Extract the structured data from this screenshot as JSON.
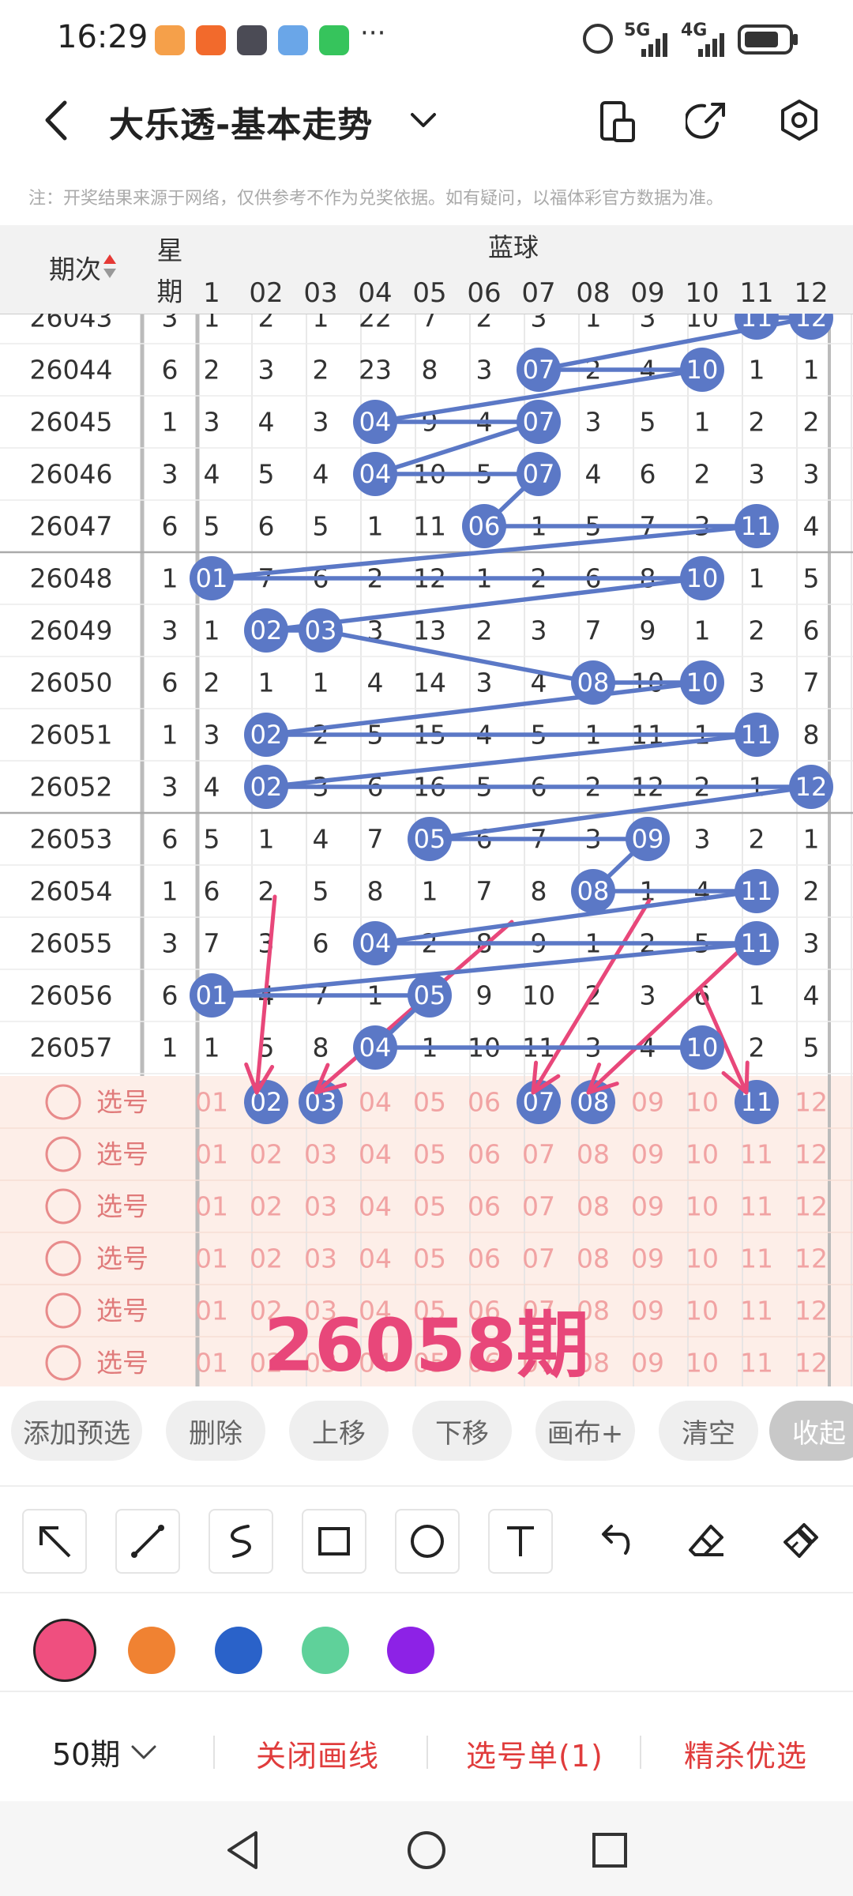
{
  "status": {
    "time": "16:29",
    "network_5g": "5G",
    "network_4g": "4G"
  },
  "header": {
    "title": "大乐透-基本走势"
  },
  "notice": "注：开奖结果来源于网络，仅供参考不作为兑奖依据。如有疑问，以福体彩官方数据为准。",
  "table": {
    "col_issue": "期次",
    "col_week": [
      "星",
      "期"
    ],
    "blue_header": "蓝球",
    "numbers": [
      "1",
      "02",
      "03",
      "04",
      "05",
      "06",
      "07",
      "08",
      "09",
      "10",
      "11",
      "12"
    ],
    "partial_row": {
      "issue": "26043",
      "week": "3",
      "values": [
        "1",
        "2",
        "1",
        "22",
        "7",
        "2",
        "3",
        "1",
        "3",
        "10",
        "11",
        "12"
      ]
    },
    "rows": [
      {
        "issue": "26044",
        "week": "6",
        "values": [
          "2",
          "3",
          "2",
          "23",
          "8",
          "3",
          "07",
          "2",
          "4",
          "10",
          "1",
          "1"
        ]
      },
      {
        "issue": "26045",
        "week": "1",
        "values": [
          "3",
          "4",
          "3",
          "04",
          "9",
          "4",
          "07",
          "3",
          "5",
          "1",
          "2",
          "2"
        ]
      },
      {
        "issue": "26046",
        "week": "3",
        "values": [
          "4",
          "5",
          "4",
          "04",
          "10",
          "5",
          "07",
          "4",
          "6",
          "2",
          "3",
          "3"
        ]
      },
      {
        "issue": "26047",
        "week": "6",
        "values": [
          "5",
          "6",
          "5",
          "1",
          "11",
          "06",
          "1",
          "5",
          "7",
          "3",
          "11",
          "4"
        ]
      },
      {
        "issue": "26048",
        "week": "1",
        "values": [
          "01",
          "7",
          "6",
          "2",
          "12",
          "1",
          "2",
          "6",
          "8",
          "10",
          "1",
          "5"
        ]
      },
      {
        "issue": "26049",
        "week": "3",
        "values": [
          "1",
          "02",
          "03",
          "3",
          "13",
          "2",
          "3",
          "7",
          "9",
          "1",
          "2",
          "6"
        ]
      },
      {
        "issue": "26050",
        "week": "6",
        "values": [
          "2",
          "1",
          "1",
          "4",
          "14",
          "3",
          "4",
          "08",
          "10",
          "10",
          "3",
          "7"
        ]
      },
      {
        "issue": "26051",
        "week": "1",
        "values": [
          "3",
          "02",
          "2",
          "5",
          "15",
          "4",
          "5",
          "1",
          "11",
          "1",
          "11",
          "8"
        ]
      },
      {
        "issue": "26052",
        "week": "3",
        "values": [
          "4",
          "02",
          "3",
          "6",
          "16",
          "5",
          "6",
          "2",
          "12",
          "2",
          "1",
          "12"
        ]
      },
      {
        "issue": "26053",
        "week": "6",
        "values": [
          "5",
          "1",
          "4",
          "7",
          "05",
          "6",
          "7",
          "3",
          "09",
          "3",
          "2",
          "1"
        ]
      },
      {
        "issue": "26054",
        "week": "1",
        "values": [
          "6",
          "2",
          "5",
          "8",
          "1",
          "7",
          "8",
          "08",
          "1",
          "4",
          "11",
          "2"
        ]
      },
      {
        "issue": "26055",
        "week": "3",
        "values": [
          "7",
          "3",
          "6",
          "04",
          "2",
          "8",
          "9",
          "1",
          "2",
          "5",
          "11",
          "3"
        ]
      },
      {
        "issue": "26056",
        "week": "6",
        "values": [
          "01",
          "4",
          "7",
          "1",
          "05",
          "9",
          "10",
          "2",
          "3",
          "6",
          "1",
          "4"
        ]
      },
      {
        "issue": "26057",
        "week": "1",
        "values": [
          "1",
          "5",
          "8",
          "04",
          "1",
          "10",
          "11",
          "3",
          "4",
          "10",
          "2",
          "5"
        ]
      }
    ],
    "hits": [
      [
        6,
        9
      ],
      [
        3,
        6
      ],
      [
        3,
        6
      ],
      [
        5,
        10
      ],
      [
        0,
        9
      ],
      [
        1,
        2
      ],
      [
        7,
        9
      ],
      [
        1,
        10
      ],
      [
        1,
        11
      ],
      [
        4,
        8
      ],
      [
        7,
        10
      ],
      [
        3,
        10
      ],
      [
        0,
        4
      ],
      [
        3,
        9
      ]
    ],
    "hit_color": "#5b78c6",
    "pick_label": "选号",
    "pick_numbers": [
      "01",
      "02",
      "03",
      "04",
      "05",
      "06",
      "07",
      "08",
      "09",
      "10",
      "11",
      "12"
    ],
    "selected_picks": [
      1,
      2,
      6,
      7,
      10
    ],
    "overlay_text": "26058期",
    "annotation_color": "#e8477a"
  },
  "actions": [
    "添加预选",
    "删除",
    "上移",
    "下移",
    "画布+",
    "清空",
    "收起"
  ],
  "tools": [
    "arrow-tool-icon",
    "line-tool-icon",
    "curve-tool-icon",
    "rectangle-tool-icon",
    "circle-tool-icon",
    "text-tool-icon",
    "undo-icon",
    "eraser-icon",
    "clear-brush-icon"
  ],
  "colors": [
    "#ef4f7f",
    "#f08232",
    "#2a62c9",
    "#5fd19a",
    "#8d22e6"
  ],
  "footer": {
    "periods": "50期",
    "close_drawing": "关闭画线",
    "pick_list": "选号单(1)",
    "best_pick": "精杀优选"
  }
}
